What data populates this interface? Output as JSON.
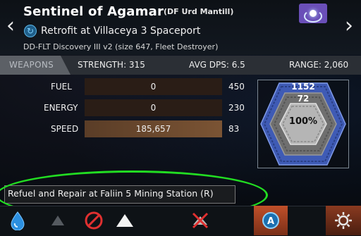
{
  "ship": {
    "name": "Sentinel of Agamar",
    "tag": "(DF Urd Mantill)",
    "status": "Retrofit at Villaceya 3 Spaceport",
    "class": "DD-FLT Discovery III v2 (size 647, Fleet Destroyer)"
  },
  "weapons": {
    "tab_label": "WEAPONS",
    "strength": "STRENGTH: 315",
    "avg_dps": "AVG DPS: 6.5",
    "range": "RANGE: 2,060"
  },
  "stats": [
    {
      "label": "FUEL",
      "value": "0",
      "max": "450",
      "fill": 0
    },
    {
      "label": "ENERGY",
      "value": "0",
      "max": "230",
      "fill": 0
    },
    {
      "label": "SPEED",
      "value": "185,657",
      "max": "83",
      "fill": 1
    }
  ],
  "shields": {
    "outer": "1152",
    "middle": "72",
    "core": "100%"
  },
  "tooltip": "Refuel and Repair at Faliin 5 Mining Station (R)",
  "toolbar": {
    "buttons": [
      {
        "name": "refuel-button",
        "icon": "fuel-drop-icon"
      },
      {
        "name": "move-down-button",
        "icon": "triangle-icon"
      },
      {
        "name": "cancel-button",
        "icon": "prohibited-icon"
      },
      {
        "name": "move-up-button",
        "icon": "triangle-icon"
      },
      {
        "name": "scrap-button",
        "icon": "crossed-ship-icon"
      },
      {
        "name": "auto-button",
        "icon": "auto-icon"
      },
      {
        "name": "settings-button",
        "icon": "gear-icon"
      }
    ]
  },
  "colors": {
    "hex_outer": "#4a6fd0",
    "hex_mid": "#7a7a7a",
    "highlight": "#22dd22",
    "bar_fill": "#7b5434",
    "toolbar_accent": "#c0502a"
  }
}
